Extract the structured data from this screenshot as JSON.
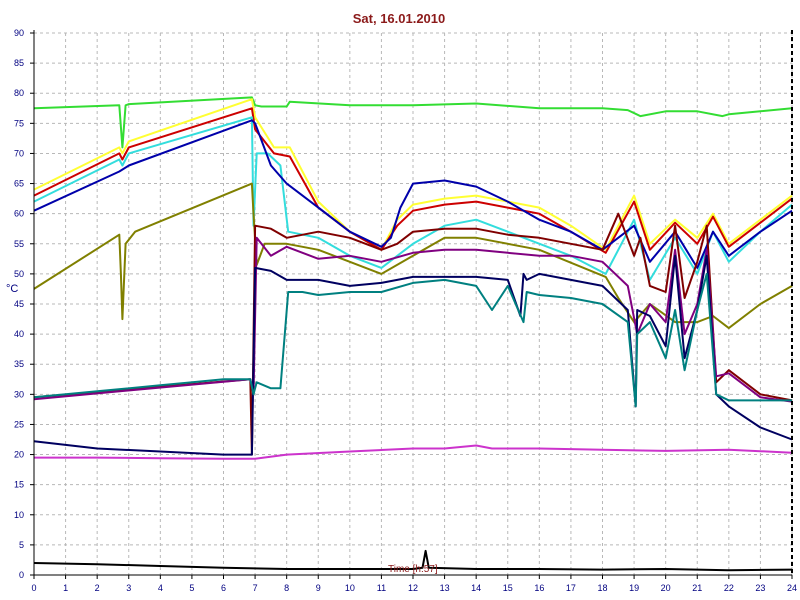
{
  "chart_data": {
    "type": "line",
    "title": "Sat, 16.01.2010",
    "xlabel": "Time [h:57]",
    "ylabel": "°C",
    "xlim": [
      0,
      24
    ],
    "ylim": [
      0,
      90
    ],
    "x_ticks": [
      0,
      1,
      2,
      3,
      4,
      5,
      6,
      7,
      8,
      9,
      10,
      11,
      12,
      13,
      14,
      15,
      16,
      17,
      18,
      19,
      20,
      21,
      22,
      23,
      24
    ],
    "y_ticks": [
      0,
      5,
      10,
      15,
      20,
      25,
      30,
      35,
      40,
      45,
      50,
      55,
      60,
      65,
      70,
      75,
      80,
      85,
      90
    ],
    "grid": true,
    "legend": "none",
    "colors": {
      "background": "#ffffff",
      "grid": "#b8b8b8",
      "axis": "#000000",
      "title": "#8b1a1a",
      "tick_text": "#000080"
    },
    "series": [
      {
        "color": "#33dd33",
        "x": [
          0,
          2.7,
          2.8,
          2.9,
          3,
          6.9,
          7.0,
          7.2,
          8,
          8.1,
          10,
          12,
          14,
          16,
          18,
          18.8,
          19.2,
          20,
          21,
          21.8,
          22,
          23,
          24
        ],
        "y": [
          77.5,
          78,
          71,
          78,
          78.2,
          79.3,
          78,
          77.8,
          77.8,
          78.6,
          78,
          78,
          78.3,
          77.5,
          77.5,
          77.2,
          76.2,
          77,
          77,
          76.2,
          76.5,
          77,
          77.5
        ]
      },
      {
        "color": "#ffff33",
        "x": [
          0,
          2.7,
          2.8,
          3,
          6.9,
          7.0,
          7.6,
          8.1,
          9,
          10,
          11,
          11.5,
          12,
          13,
          14,
          16,
          17,
          18.1,
          19,
          19.5,
          20.3,
          21,
          21.5,
          22,
          23,
          24
        ],
        "y": [
          64,
          71,
          70,
          72,
          79,
          76,
          71,
          71,
          62,
          57,
          54,
          59,
          61.5,
          62.5,
          63,
          61,
          58,
          54,
          63,
          55,
          59,
          56,
          60,
          55,
          59,
          63
        ]
      },
      {
        "color": "#cc0000",
        "x": [
          0,
          2.7,
          2.8,
          3,
          6.9,
          7.0,
          7.6,
          8.1,
          9,
          10,
          11,
          11.5,
          12,
          13,
          14,
          16,
          17,
          18.1,
          19,
          19.5,
          20.3,
          21,
          21.5,
          22,
          23,
          24
        ],
        "y": [
          63,
          70,
          69,
          71,
          77.5,
          74,
          70,
          69.5,
          61,
          57,
          54,
          58,
          60.5,
          61.5,
          62,
          60,
          57,
          53.5,
          62,
          54,
          58.5,
          55,
          59.5,
          54.5,
          58.5,
          62.5
        ]
      },
      {
        "color": "#33dddd",
        "x": [
          0,
          2.7,
          2.8,
          3,
          6.9,
          6.95,
          7.05,
          7.4,
          7.8,
          8.05,
          9,
          10,
          11,
          12,
          13,
          14,
          15,
          17,
          18.1,
          19,
          19.5,
          20.3,
          21,
          21.5,
          22,
          23,
          24
        ],
        "y": [
          62,
          69,
          68,
          70,
          76,
          58,
          70,
          70,
          68,
          57,
          56,
          53,
          51,
          55,
          58,
          59,
          57,
          53,
          50,
          59,
          49,
          56,
          50,
          57,
          52,
          57,
          61.5
        ]
      },
      {
        "color": "#0000aa",
        "x": [
          0,
          2.7,
          3,
          6.9,
          7.0,
          7.5,
          8,
          9,
          10,
          11,
          11.3,
          11.6,
          12,
          13,
          14,
          15,
          16,
          17,
          18,
          19,
          19.5,
          20.3,
          21,
          21.5,
          22,
          23,
          24
        ],
        "y": [
          60.5,
          67,
          68,
          75.5,
          75,
          68,
          65,
          61,
          57,
          54.5,
          56,
          61,
          65,
          65.5,
          64.5,
          62,
          59,
          57,
          54,
          58,
          52,
          57,
          51,
          57,
          53,
          57,
          60.5
        ]
      },
      {
        "color": "#808000",
        "x": [
          0,
          2.7,
          2.75,
          2.8,
          2.9,
          3.2,
          6.9,
          6.95,
          7.05,
          7.3,
          8,
          9,
          10,
          11,
          12,
          13,
          14,
          16,
          18.1,
          18.5,
          19,
          19.5,
          20.3,
          21,
          21.5,
          22,
          23,
          24
        ],
        "y": [
          47.5,
          56.5,
          50,
          42.5,
          55,
          57,
          65,
          60,
          51.5,
          55,
          55,
          54,
          52,
          50,
          53,
          56,
          56,
          54,
          49.5,
          46,
          42,
          45,
          42,
          42,
          43,
          41,
          45,
          48
        ]
      },
      {
        "color": "#800000",
        "x": [
          0,
          6.85,
          6.9,
          7.0,
          7.5,
          8,
          9,
          10,
          11,
          11.5,
          12,
          13,
          14,
          15,
          16,
          17,
          18,
          18.5,
          19,
          19.2,
          19.5,
          20,
          20.3,
          20.6,
          21,
          21.3,
          21.6,
          22,
          23,
          24
        ],
        "y": [
          29.5,
          32.5,
          20,
          58,
          57.5,
          56,
          57,
          56,
          54,
          55,
          57,
          57.5,
          57.5,
          56.5,
          56,
          55,
          54,
          60,
          53,
          56,
          48,
          47,
          58,
          46,
          52,
          58,
          32,
          34,
          30,
          29
        ]
      },
      {
        "color": "#800080",
        "x": [
          0,
          6.85,
          6.95,
          7.05,
          7.5,
          8,
          9,
          10,
          11,
          12,
          13,
          14,
          15,
          16,
          17,
          18,
          18.8,
          19.1,
          19.5,
          20,
          20.3,
          20.6,
          21,
          21.3,
          21.6,
          22,
          23,
          24
        ],
        "y": [
          29.2,
          32.5,
          30,
          56,
          53,
          54.5,
          52.5,
          53,
          52,
          53.5,
          54,
          54,
          53.5,
          53,
          53,
          52,
          48,
          40,
          45,
          42,
          54,
          40,
          45,
          54,
          33,
          33.5,
          29.5,
          28.8
        ]
      },
      {
        "color": "#000060",
        "x": [
          0,
          2,
          4,
          6,
          6.85,
          6.9,
          7.0,
          7.5,
          8,
          9,
          10,
          11,
          12,
          13,
          14,
          15,
          15.4,
          15.5,
          15.6,
          16,
          17,
          18,
          18.8,
          19.05,
          19.1,
          19.5,
          20,
          20.3,
          20.6,
          21,
          21.3,
          21.6,
          22,
          23,
          24
        ],
        "y": [
          22.2,
          21,
          20.5,
          20,
          20,
          20,
          51,
          50.5,
          49,
          49,
          48,
          48.5,
          49.5,
          49.5,
          49.5,
          49,
          43,
          50,
          49,
          50,
          49,
          48,
          44,
          28,
          44,
          43,
          38,
          53,
          36,
          44,
          53,
          30,
          28,
          24.5,
          22.5
        ]
      },
      {
        "color": "#008080",
        "x": [
          0,
          2,
          4,
          6,
          6.85,
          6.95,
          7.05,
          7.5,
          7.8,
          8.05,
          8.5,
          9,
          10,
          11,
          12,
          13,
          14,
          14.5,
          15,
          15.5,
          15.6,
          16,
          17,
          18,
          18.8,
          19.05,
          19.1,
          19.5,
          20,
          20.3,
          20.6,
          21,
          21.3,
          21.6,
          22,
          23,
          24
        ],
        "y": [
          29.5,
          30.5,
          31.5,
          32.5,
          32.5,
          30,
          32,
          31,
          31,
          47,
          47,
          46.5,
          47,
          47,
          48.5,
          49,
          48,
          44,
          48,
          42,
          47,
          46.5,
          46,
          45,
          42,
          28,
          40,
          42,
          36,
          44,
          34,
          44,
          50,
          30,
          29,
          29,
          29
        ]
      },
      {
        "color": "#cc33cc",
        "x": [
          0,
          2,
          4,
          6,
          7,
          8,
          10,
          12,
          13,
          14,
          14.5,
          16,
          18,
          20,
          22,
          24
        ],
        "y": [
          19.5,
          19.5,
          19.4,
          19.3,
          19.3,
          20,
          20.5,
          21,
          21,
          21.5,
          21,
          21,
          20.8,
          20.6,
          20.8,
          20.3
        ]
      },
      {
        "color": "#000000",
        "x": [
          0,
          2,
          4,
          6,
          8,
          10,
          12,
          12.3,
          12.4,
          12.5,
          14,
          16,
          18,
          20,
          22,
          24
        ],
        "y": [
          2,
          1.8,
          1.5,
          1.2,
          1.0,
          1.0,
          1.0,
          1.2,
          4,
          1.2,
          1.0,
          1.0,
          0.9,
          1.0,
          0.8,
          0.9
        ]
      }
    ]
  }
}
